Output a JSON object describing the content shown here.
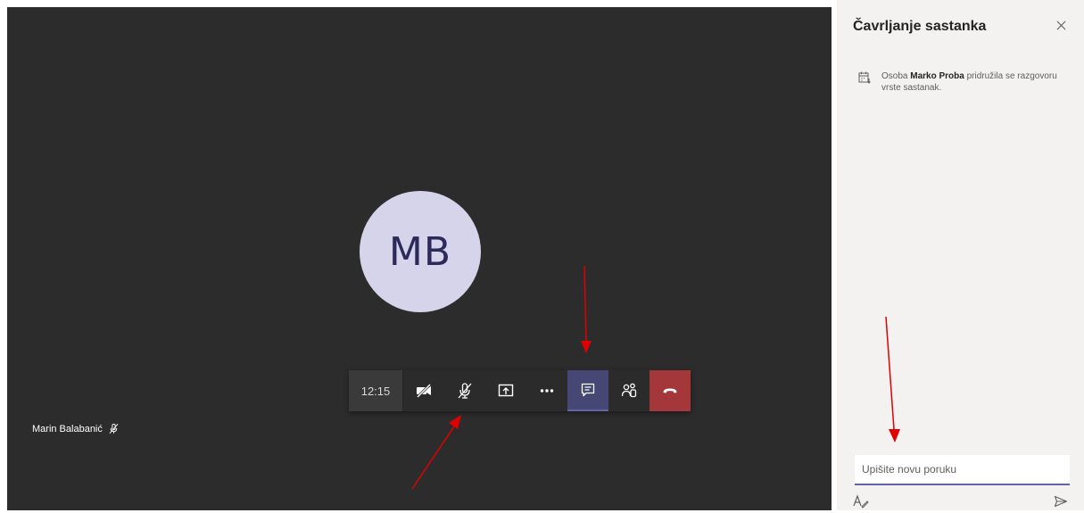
{
  "stage": {
    "avatar_initials": "MB",
    "participant_name": "Marin Balabanić"
  },
  "controls": {
    "timer": "12:15",
    "buttons": [
      {
        "name": "camera-off",
        "icon": "video-off-icon"
      },
      {
        "name": "mic-muted",
        "icon": "mic-off-icon"
      },
      {
        "name": "share",
        "icon": "share-screen-icon"
      },
      {
        "name": "more",
        "icon": "more-icon"
      },
      {
        "name": "chat",
        "icon": "chat-icon",
        "active": true
      },
      {
        "name": "participants",
        "icon": "people-icon"
      },
      {
        "name": "hang-up",
        "icon": "hangup-icon"
      }
    ]
  },
  "chat_panel": {
    "title": "Čavrljanje sastanka",
    "event": {
      "prefix": "Osoba",
      "person": "Marko Proba",
      "suffix": "pridružila se razgovoru vrste sastanak."
    },
    "compose_placeholder": "Upišite novu poruku"
  },
  "colors": {
    "stage_bg": "#2d2c2c",
    "panel_bg": "#f3f2f1",
    "accent": "#6264a7",
    "hangup": "#a4373a",
    "annotation_arrow": "#e00000"
  }
}
